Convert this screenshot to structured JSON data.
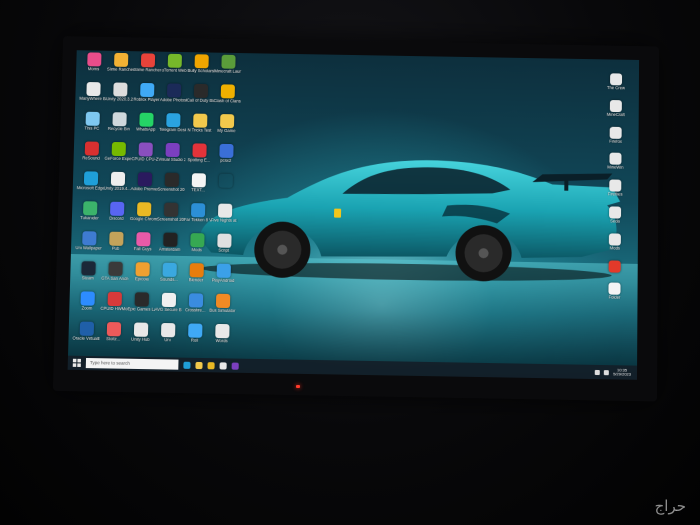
{
  "desktop": {
    "left_icons": [
      {
        "label": "Moms",
        "color": "#e84d8a"
      },
      {
        "label": "Slime Rancher",
        "color": "#f2b134"
      },
      {
        "label": "Slime Rancher",
        "color": "#e8433a"
      },
      {
        "label": "uTorrent Web",
        "color": "#76b82a"
      },
      {
        "label": "Bully Scholarship",
        "color": "#f0a500"
      },
      {
        "label": "Minecraft Launcher",
        "color": "#5a9c3a"
      },
      {
        "label": "ManyWhere Backup",
        "color": "#e8e8e8"
      },
      {
        "label": "Unity 2020.3.24...",
        "color": "#dddddd"
      },
      {
        "label": "Roblox Player",
        "color": "#3fa9f5"
      },
      {
        "label": "Adobe Photoshop",
        "color": "#1b2a58"
      },
      {
        "label": "Call of Duty Black Ops III",
        "color": "#2a2a2a"
      },
      {
        "label": "Clash of Clans",
        "color": "#f0b000"
      },
      {
        "label": "This PC",
        "color": "#7ec8f0"
      },
      {
        "label": "Recycle Bin",
        "color": "#cfd8dc"
      },
      {
        "label": "WhatsApp",
        "color": "#25d366"
      },
      {
        "label": "Telegram Desktop",
        "color": "#2aa3e0"
      },
      {
        "label": "N Tricks Test",
        "color": "#f2c94c"
      },
      {
        "label": "My Game",
        "color": "#f2c94c"
      },
      {
        "label": "ReSound",
        "color": "#d83030"
      },
      {
        "label": "GeForce Experience",
        "color": "#76b900"
      },
      {
        "label": "CPUID CPU-Z",
        "color": "#8a4fbf"
      },
      {
        "label": "Visual Studio 2019",
        "color": "#7b3fbf"
      },
      {
        "label": "Spotting E...",
        "color": "#e2333a"
      },
      {
        "label": "pcsx2",
        "color": "#3a6fd8"
      },
      {
        "label": "Microsoft Edge",
        "color": "#1f9fd8"
      },
      {
        "label": "Unity 2019.4...",
        "color": "#eeeeee"
      },
      {
        "label": "Adobe Premiere Pro",
        "color": "#2a1a5e"
      },
      {
        "label": "Screenshot 2023-05...",
        "color": "#2a2a2a"
      },
      {
        "label": "TEXT...",
        "color": "#f4f4f4"
      },
      {
        "label": "",
        "color": "rgba(0,0,0,0)"
      },
      {
        "label": "Tukanider",
        "color": "#3bb36b"
      },
      {
        "label": "Discord",
        "color": "#5865f2"
      },
      {
        "label": "Google Chrome",
        "color": "#e9b824"
      },
      {
        "label": "Screenshot 2023-05...",
        "color": "#333333"
      },
      {
        "label": "Far Tekken 8 Village",
        "color": "#2c8fd6"
      },
      {
        "label": "Five Nights at Freddy's",
        "color": "#e8e8e8"
      },
      {
        "label": "Uni Wallpaper",
        "color": "#3e7bd1"
      },
      {
        "label": "Pub",
        "color": "#c4a35a"
      },
      {
        "label": "Fall Guys",
        "color": "#e85aa8"
      },
      {
        "label": "Amsterdam",
        "color": "#222222"
      },
      {
        "label": "Mods",
        "color": "#36a852"
      },
      {
        "label": "Script",
        "color": "#e0e0e0"
      },
      {
        "label": "Steam",
        "color": "#1b2838"
      },
      {
        "label": "GTA San Andreas",
        "color": "#3a3a3a"
      },
      {
        "label": "Epicoia",
        "color": "#f0a030"
      },
      {
        "label": "Sounds...",
        "color": "#3aa8e0"
      },
      {
        "label": "Blender",
        "color": "#e87d0d"
      },
      {
        "label": "PlayAndroid",
        "color": "#3ba0e8"
      },
      {
        "label": "Zoom",
        "color": "#2d8cff"
      },
      {
        "label": "CPUID HWMonitor",
        "color": "#d83a3a"
      },
      {
        "label": "Epic Games Launcher",
        "color": "#2a2a2a"
      },
      {
        "label": "AVG Secure Browser",
        "color": "#f0f0f0"
      },
      {
        "label": "Crossfire...",
        "color": "#3a8ce0"
      },
      {
        "label": "Bus Simulator",
        "color": "#f08a24"
      },
      {
        "label": "Oracle VirtualBox",
        "color": "#1f5fa8"
      },
      {
        "label": "Stoltz...",
        "color": "#ec5a5a"
      },
      {
        "label": "Unity Hub",
        "color": "#e8e8e8"
      },
      {
        "label": "Uni",
        "color": "#e8e8e8"
      },
      {
        "label": "Roll",
        "color": "#3fa9f5"
      },
      {
        "label": "Words",
        "color": "#e8e8e8"
      }
    ],
    "right_icons": [
      {
        "label": "The Crew",
        "color": "#e8e8e8"
      },
      {
        "label": "MineCraft",
        "color": "#e8e8e8"
      },
      {
        "label": "Firefox",
        "color": "#e8e8e8"
      },
      {
        "label": "MineWin",
        "color": "#e8e8e8"
      },
      {
        "label": "Fireflies",
        "color": "#e8e8e8"
      },
      {
        "label": "Seda",
        "color": "#e8e8e8"
      },
      {
        "label": "Mods",
        "color": "#e8e8e8"
      },
      {
        "label": "",
        "color": "#e23a2a"
      },
      {
        "label": "Folder",
        "color": "#f4f4f4"
      }
    ]
  },
  "taskbar": {
    "search_placeholder": "Type here to search",
    "apps": [
      "#1f9fd8",
      "#f2c94c",
      "#e9b824",
      "#e8e8e8",
      "#7b3fbf"
    ],
    "clock_time": "10:35",
    "clock_date": "5/29/2023"
  },
  "watermark": "حراج"
}
